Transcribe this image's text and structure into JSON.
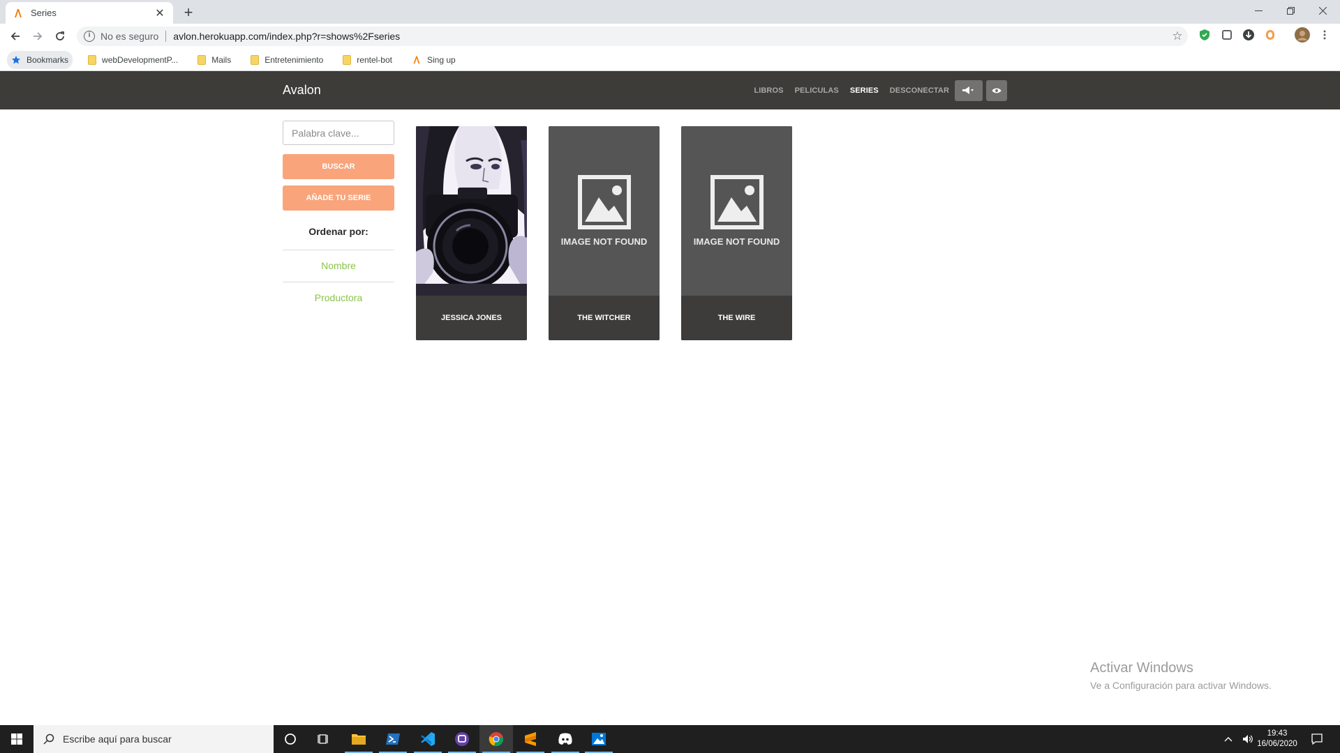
{
  "browser": {
    "tab_title": "Series",
    "new_tab_symbol": "+",
    "close_symbol": "✕",
    "omnibox": {
      "security_label": "No es seguro",
      "url": "avlon.herokuapp.com/index.php?r=shows%2Fseries"
    },
    "bookmarks": [
      {
        "label": "Bookmarks",
        "icon": "star-icon"
      },
      {
        "label": "webDevelopmentP...",
        "icon": "folder-icon"
      },
      {
        "label": "Mails",
        "icon": "folder-icon"
      },
      {
        "label": "Entretenimiento",
        "icon": "folder-icon"
      },
      {
        "label": "rentel-bot",
        "icon": "folder-icon"
      },
      {
        "label": "Sing up",
        "icon": "avalon-favicon"
      }
    ]
  },
  "site": {
    "brand": "Avalon",
    "nav": [
      {
        "label": "LIBROS",
        "active": false
      },
      {
        "label": "PELICULAS",
        "active": false
      },
      {
        "label": "SERIES",
        "active": true
      },
      {
        "label": "DESCONECTAR",
        "active": false
      }
    ],
    "accent_color": "#f9a47a",
    "link_color": "#8bc34a",
    "navbar_color": "#3d3c39"
  },
  "sidebar": {
    "search_placeholder": "Palabra clave...",
    "search_button": "BUSCAR",
    "add_button": "AÑADE TU SERIE",
    "order_title": "Ordenar por:",
    "order_options": [
      "Nombre",
      "Productora"
    ]
  },
  "cards": [
    {
      "title": "JESSICA JONES",
      "image": "photo"
    },
    {
      "title": "THE WITCHER",
      "image": "not-found",
      "placeholder_text": "IMAGE NOT FOUND"
    },
    {
      "title": "THE WIRE",
      "image": "not-found",
      "placeholder_text": "IMAGE NOT FOUND"
    }
  ],
  "watermark": {
    "title": "Activar Windows",
    "subtitle": "Ve a Configuración para activar Windows."
  },
  "taskbar": {
    "search_placeholder": "Escribe aquí para buscar",
    "time": "19:43",
    "date": "16/06/2020"
  }
}
